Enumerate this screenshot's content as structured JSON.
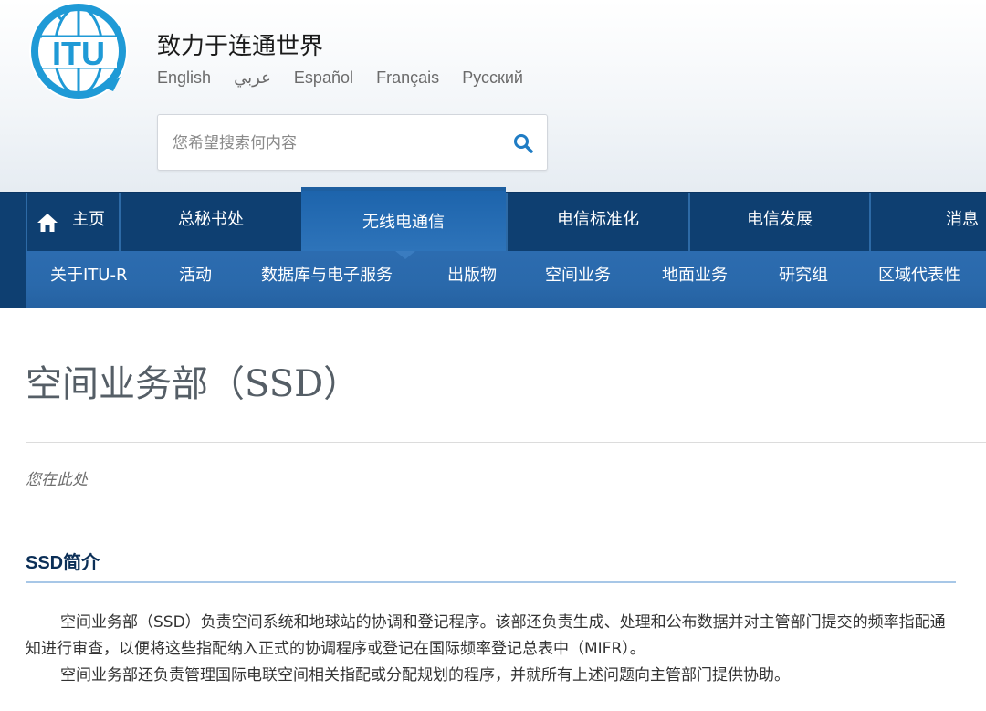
{
  "header": {
    "logo_text": "ITU",
    "tagline": "致力于连通世界",
    "languages": [
      "English",
      "عربي",
      "Español",
      "Français",
      "Русский"
    ]
  },
  "search": {
    "placeholder": "您希望搜索何内容",
    "icon": "search-icon"
  },
  "nav_primary": {
    "items": [
      "主页",
      "总秘书处",
      "无线电通信",
      "电信标准化",
      "电信发展",
      "消息"
    ],
    "active": "无线电通信",
    "home_icon": "home-icon"
  },
  "nav_secondary": {
    "items": [
      "关于ITU-R",
      "活动",
      "数据库与电子服务",
      "出版物",
      "空间业务",
      "地面业务",
      "研究组",
      "区域代表性"
    ]
  },
  "page": {
    "title": "空间业务部（SSD）",
    "breadcrumb": "您在此处"
  },
  "section": {
    "title": "SSD简介",
    "paragraphs": [
      "空间业务部（SSD）负责空间系统和地球站的协调和登记程序。该部还负责生成、处理和公布数据并对主管部门提交的频率指配通知进行审查，以便将这些指配纳入正式的协调程序或登记在国际频率登记总表中（MIFR）。",
      "空间业务部还负责管理国际电联空间相关指配或分配规划的程序，并就所有上述问题向主管部门提供协助。"
    ]
  },
  "colors": {
    "nav_dark": "#0e3f71",
    "nav_active": "#2e74ba",
    "nav_secondary": "#2a69ab",
    "logo_blue": "#1f9ad6",
    "section_title": "#0b2f57"
  }
}
